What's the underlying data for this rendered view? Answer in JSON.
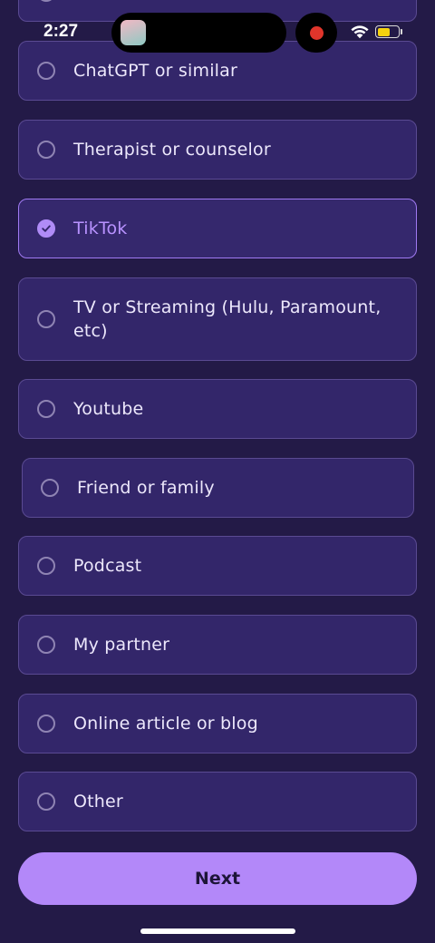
{
  "status_bar": {
    "time": "2:27",
    "battery_level": 0.62
  },
  "options": [
    {
      "label": "ChatGPT or similar",
      "selected": false
    },
    {
      "label": "Therapist or counselor",
      "selected": false
    },
    {
      "label": "TikTok",
      "selected": true
    },
    {
      "label": "TV or Streaming (Hulu, Paramount, etc)",
      "selected": false
    },
    {
      "label": "Youtube",
      "selected": false
    },
    {
      "label": "Friend or family",
      "selected": false
    },
    {
      "label": "Podcast",
      "selected": false
    },
    {
      "label": "My partner",
      "selected": false
    },
    {
      "label": "Online article or blog",
      "selected": false
    },
    {
      "label": "Other",
      "selected": false
    }
  ],
  "next_button": {
    "label": "Next"
  },
  "colors": {
    "background": "#231a47",
    "card": "#33266a",
    "card_border": "#5a4a92",
    "accent": "#b388f9",
    "selected_text": "#b892ff"
  }
}
